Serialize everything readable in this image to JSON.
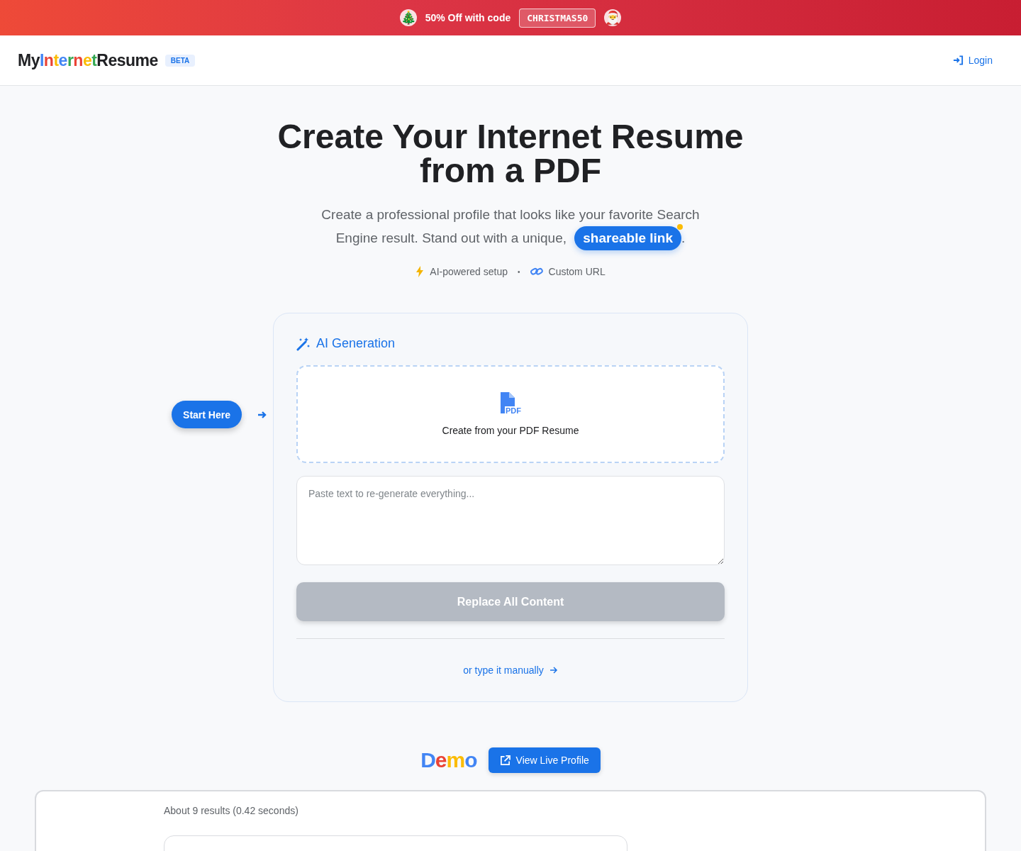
{
  "promo": {
    "icon_left": "🎄",
    "text": "50% Off with code",
    "code": "CHRISTMAS50",
    "icon_right": "🎅"
  },
  "header": {
    "logo": [
      {
        "text": "My",
        "color": "#202124"
      },
      {
        "text": "I",
        "color": "#4285f4"
      },
      {
        "text": "n",
        "color": "#ea4335"
      },
      {
        "text": "t",
        "color": "#fbbc05"
      },
      {
        "text": "e",
        "color": "#4285f4"
      },
      {
        "text": "r",
        "color": "#34a853"
      },
      {
        "text": "n",
        "color": "#ea4335"
      },
      {
        "text": "e",
        "color": "#fbbc05"
      },
      {
        "text": "t",
        "color": "#34a853"
      },
      {
        "text": "Resume",
        "color": "#202124"
      }
    ],
    "badge": "BETA",
    "login": "Login"
  },
  "hero": {
    "title": "Create Your Internet Resume from a PDF",
    "subtitle": "Create a professional profile that looks like your favorite Search Engine result. Stand out with a unique,",
    "highlight": "shareable link",
    "after": ".",
    "features": [
      "AI-powered setup",
      "Custom URL"
    ],
    "separator": "•"
  },
  "start_button": "Start Here",
  "card": {
    "title": "AI Generation",
    "upload": {
      "label": "Create from your PDF Resume",
      "pdf_tag": "PDF"
    },
    "textarea": {
      "placeholder": "Paste text to re-generate everything..."
    },
    "replace_button": {
      "label": "Replace All Content",
      "disabled": true
    },
    "manual_link": "or type it manually"
  },
  "demo": {
    "letters": [
      {
        "text": "D",
        "color": "#4285f4"
      },
      {
        "text": "e",
        "color": "#ea4335"
      },
      {
        "text": "m",
        "color": "#fbbc05"
      },
      {
        "text": "o",
        "color": "#4285f4"
      }
    ],
    "button": "View Live Profile",
    "results": "About 9 results (0.42 seconds)"
  }
}
